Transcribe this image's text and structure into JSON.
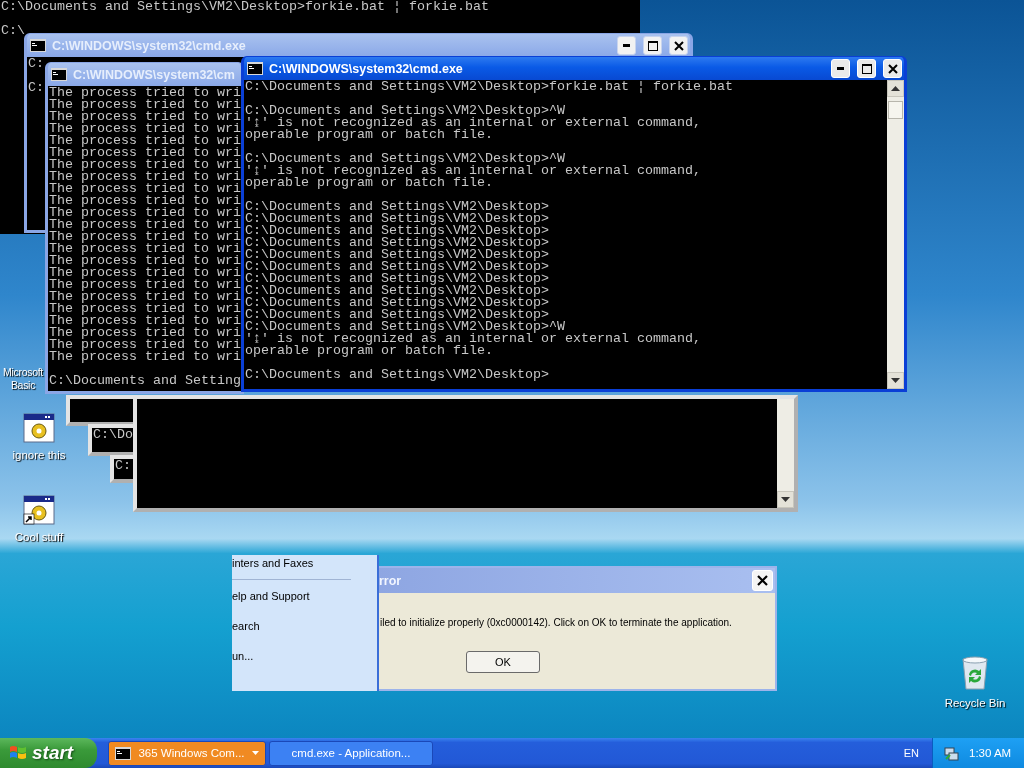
{
  "background_console": {
    "blocks": [
      [
        "C:\\Documents and Settings\\VM2\\Desktop>forkie.bat ¦ forkie.bat"
      ],
      [
        "C:\\"
      ]
    ]
  },
  "desktop_icons": [
    {
      "kind": "caption",
      "label": "Microsoft Basic"
    },
    {
      "kind": "program",
      "label": "ignore this"
    },
    {
      "kind": "shortcut",
      "label": "Cool stuff"
    },
    {
      "kind": "recycle_bin",
      "label": "Recycle Bin"
    }
  ],
  "windows": [
    {
      "kind": "console",
      "title": "C:\\WINDOWS\\system32\\cmd.exe",
      "active": false,
      "title_buttons": true,
      "blocks": [
        [
          "C:"
        ],
        [
          "C:"
        ]
      ]
    },
    {
      "kind": "console",
      "title": "C:\\WINDOWS\\system32\\cm",
      "active": false,
      "blocks": [
        [
          "The process tried to wri",
          "The process tried to wri",
          "The process tried to wri",
          "The process tried to wri",
          "The process tried to wri",
          "The process tried to wri",
          "The process tried to wri",
          "The process tried to wri",
          "The process tried to wri",
          "The process tried to wri",
          "The process tried to wri",
          "The process tried to wri",
          "The process tried to wri",
          "The process tried to wri",
          "The process tried to wri",
          "The process tried to wri",
          "The process tried to wri",
          "The process tried to wri",
          "The process tried to wri",
          "The process tried to wri",
          "The process tried to wri",
          "The process tried to wri",
          "The process tried to wri"
        ],
        [
          "C:\\Documents and Setting"
        ]
      ]
    },
    {
      "kind": "ghost"
    },
    {
      "kind": "ghost",
      "blocks": [
        [
          "C:\\Do"
        ]
      ]
    },
    {
      "kind": "ghost",
      "blocks": [
        [
          "C:"
        ]
      ]
    },
    {
      "kind": "ghost",
      "scrollbar": true
    },
    {
      "kind": "console",
      "title": "C:\\WINDOWS\\system32\\cmd.exe",
      "active": true,
      "title_buttons": true,
      "scrollbar": true,
      "blocks": [
        [
          "C:\\Documents and Settings\\VM2\\Desktop>forkie.bat ¦ forkie.bat"
        ],
        [
          "C:\\Documents and Settings\\VM2\\Desktop>^W",
          "'↨' is not recognized as an internal or external command,",
          "operable program or batch file."
        ],
        [
          "C:\\Documents and Settings\\VM2\\Desktop>^W",
          "'↨' is not recognized as an internal or external command,",
          "operable program or batch file."
        ],
        [
          "C:\\Documents and Settings\\VM2\\Desktop>",
          "C:\\Documents and Settings\\VM2\\Desktop>",
          "C:\\Documents and Settings\\VM2\\Desktop>",
          "C:\\Documents and Settings\\VM2\\Desktop>",
          "C:\\Documents and Settings\\VM2\\Desktop>",
          "C:\\Documents and Settings\\VM2\\Desktop>",
          "C:\\Documents and Settings\\VM2\\Desktop>",
          "C:\\Documents and Settings\\VM2\\Desktop>",
          "C:\\Documents and Settings\\VM2\\Desktop>",
          "C:\\Documents and Settings\\VM2\\Desktop>",
          "C:\\Documents and Settings\\VM2\\Desktop>^W",
          "'↨' is not recognized as an internal or external command,",
          "operable program or batch file."
        ],
        [
          "C:\\Documents and Settings\\VM2\\Desktop>"
        ]
      ]
    }
  ],
  "start_menu": {
    "items": [
      {
        "kind": "item",
        "label": "inters and Faxes"
      },
      {
        "kind": "separator"
      },
      {
        "kind": "item",
        "label": "elp and Support"
      },
      {
        "kind": "item",
        "label": "earch"
      },
      {
        "kind": "item",
        "label": "un..."
      }
    ]
  },
  "error_dialog": {
    "title": "rror",
    "message": "iled to initialize properly (0xc0000142). Click on OK to terminate the application.",
    "button": "OK"
  },
  "taskbar": {
    "start": "start",
    "tasks": [
      {
        "kind": "group",
        "label": "365 Windows Com...",
        "flashing": true
      },
      {
        "kind": "single",
        "label": "cmd.exe - Application...",
        "flashing": false
      }
    ],
    "language": "EN",
    "clock": "1:30 AM"
  }
}
